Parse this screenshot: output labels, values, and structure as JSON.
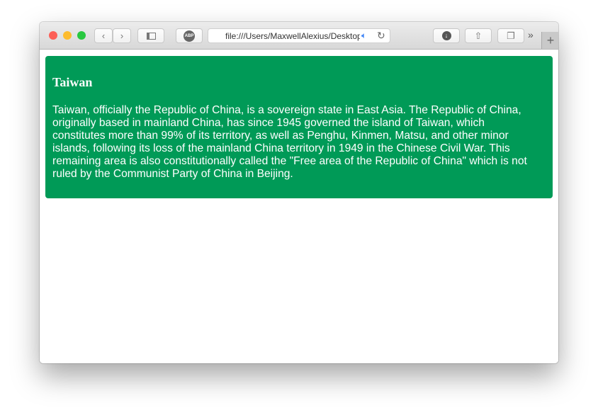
{
  "browser": {
    "url": "file:///Users/MaxwellAlexius/Desktop",
    "buttons": {
      "back": "‹",
      "forward": "›",
      "sidebar": "sidebar",
      "adblock": "ABP",
      "download": "download",
      "share": "share",
      "tabs": "tabs",
      "more": "»",
      "new_tab": "+"
    }
  },
  "page": {
    "title": "Taiwan",
    "lines": [
      "Taiwan, officially the Republic of China, is a sovereign state in East Asia. The Republic of China,",
      "originally based in mainland China, has since 1945 governed the island of Taiwan, which",
      "constitutes more than 99% of its territory, as well as Penghu, Kinmen, Matsu, and other minor",
      "islands, following its loss of the mainland China territory in 1949 in the Chinese Civil War. This",
      "remaining area is also constitutionally called the \"Free area of the Republic of China\" which is not",
      "ruled by the Communist Party of China in Beijing."
    ],
    "card_color": "#009a57"
  }
}
